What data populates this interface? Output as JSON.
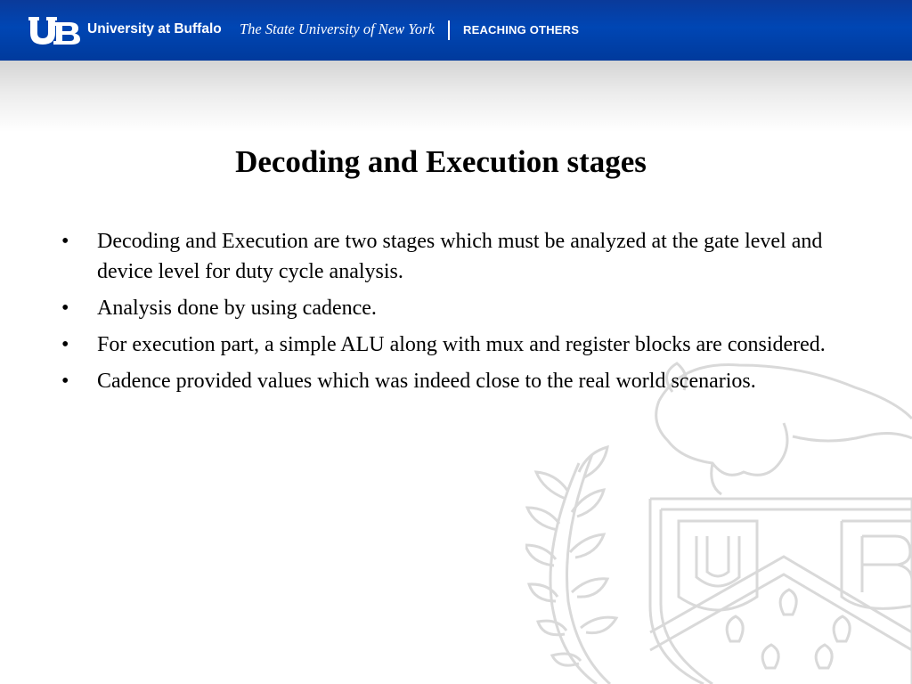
{
  "header": {
    "university_name": "University at Buffalo",
    "state_name": "The State University of New York",
    "tagline": "REACHING OTHERS",
    "bar_color": "#0046b4",
    "logo_icon": "ub-logo-icon",
    "watermark_icon": "ub-seal-watermark-icon"
  },
  "slide": {
    "title": "Decoding and Execution stages",
    "bullet_symbol": "•",
    "bullets": [
      "Decoding and Execution are two stages which must be analyzed at the gate level and device level for duty cycle analysis.",
      "Analysis done by using cadence.",
      "For execution part, a simple ALU along with mux and register blocks are considered.",
      "Cadence provided values which was indeed close to the real world scenarios."
    ]
  }
}
